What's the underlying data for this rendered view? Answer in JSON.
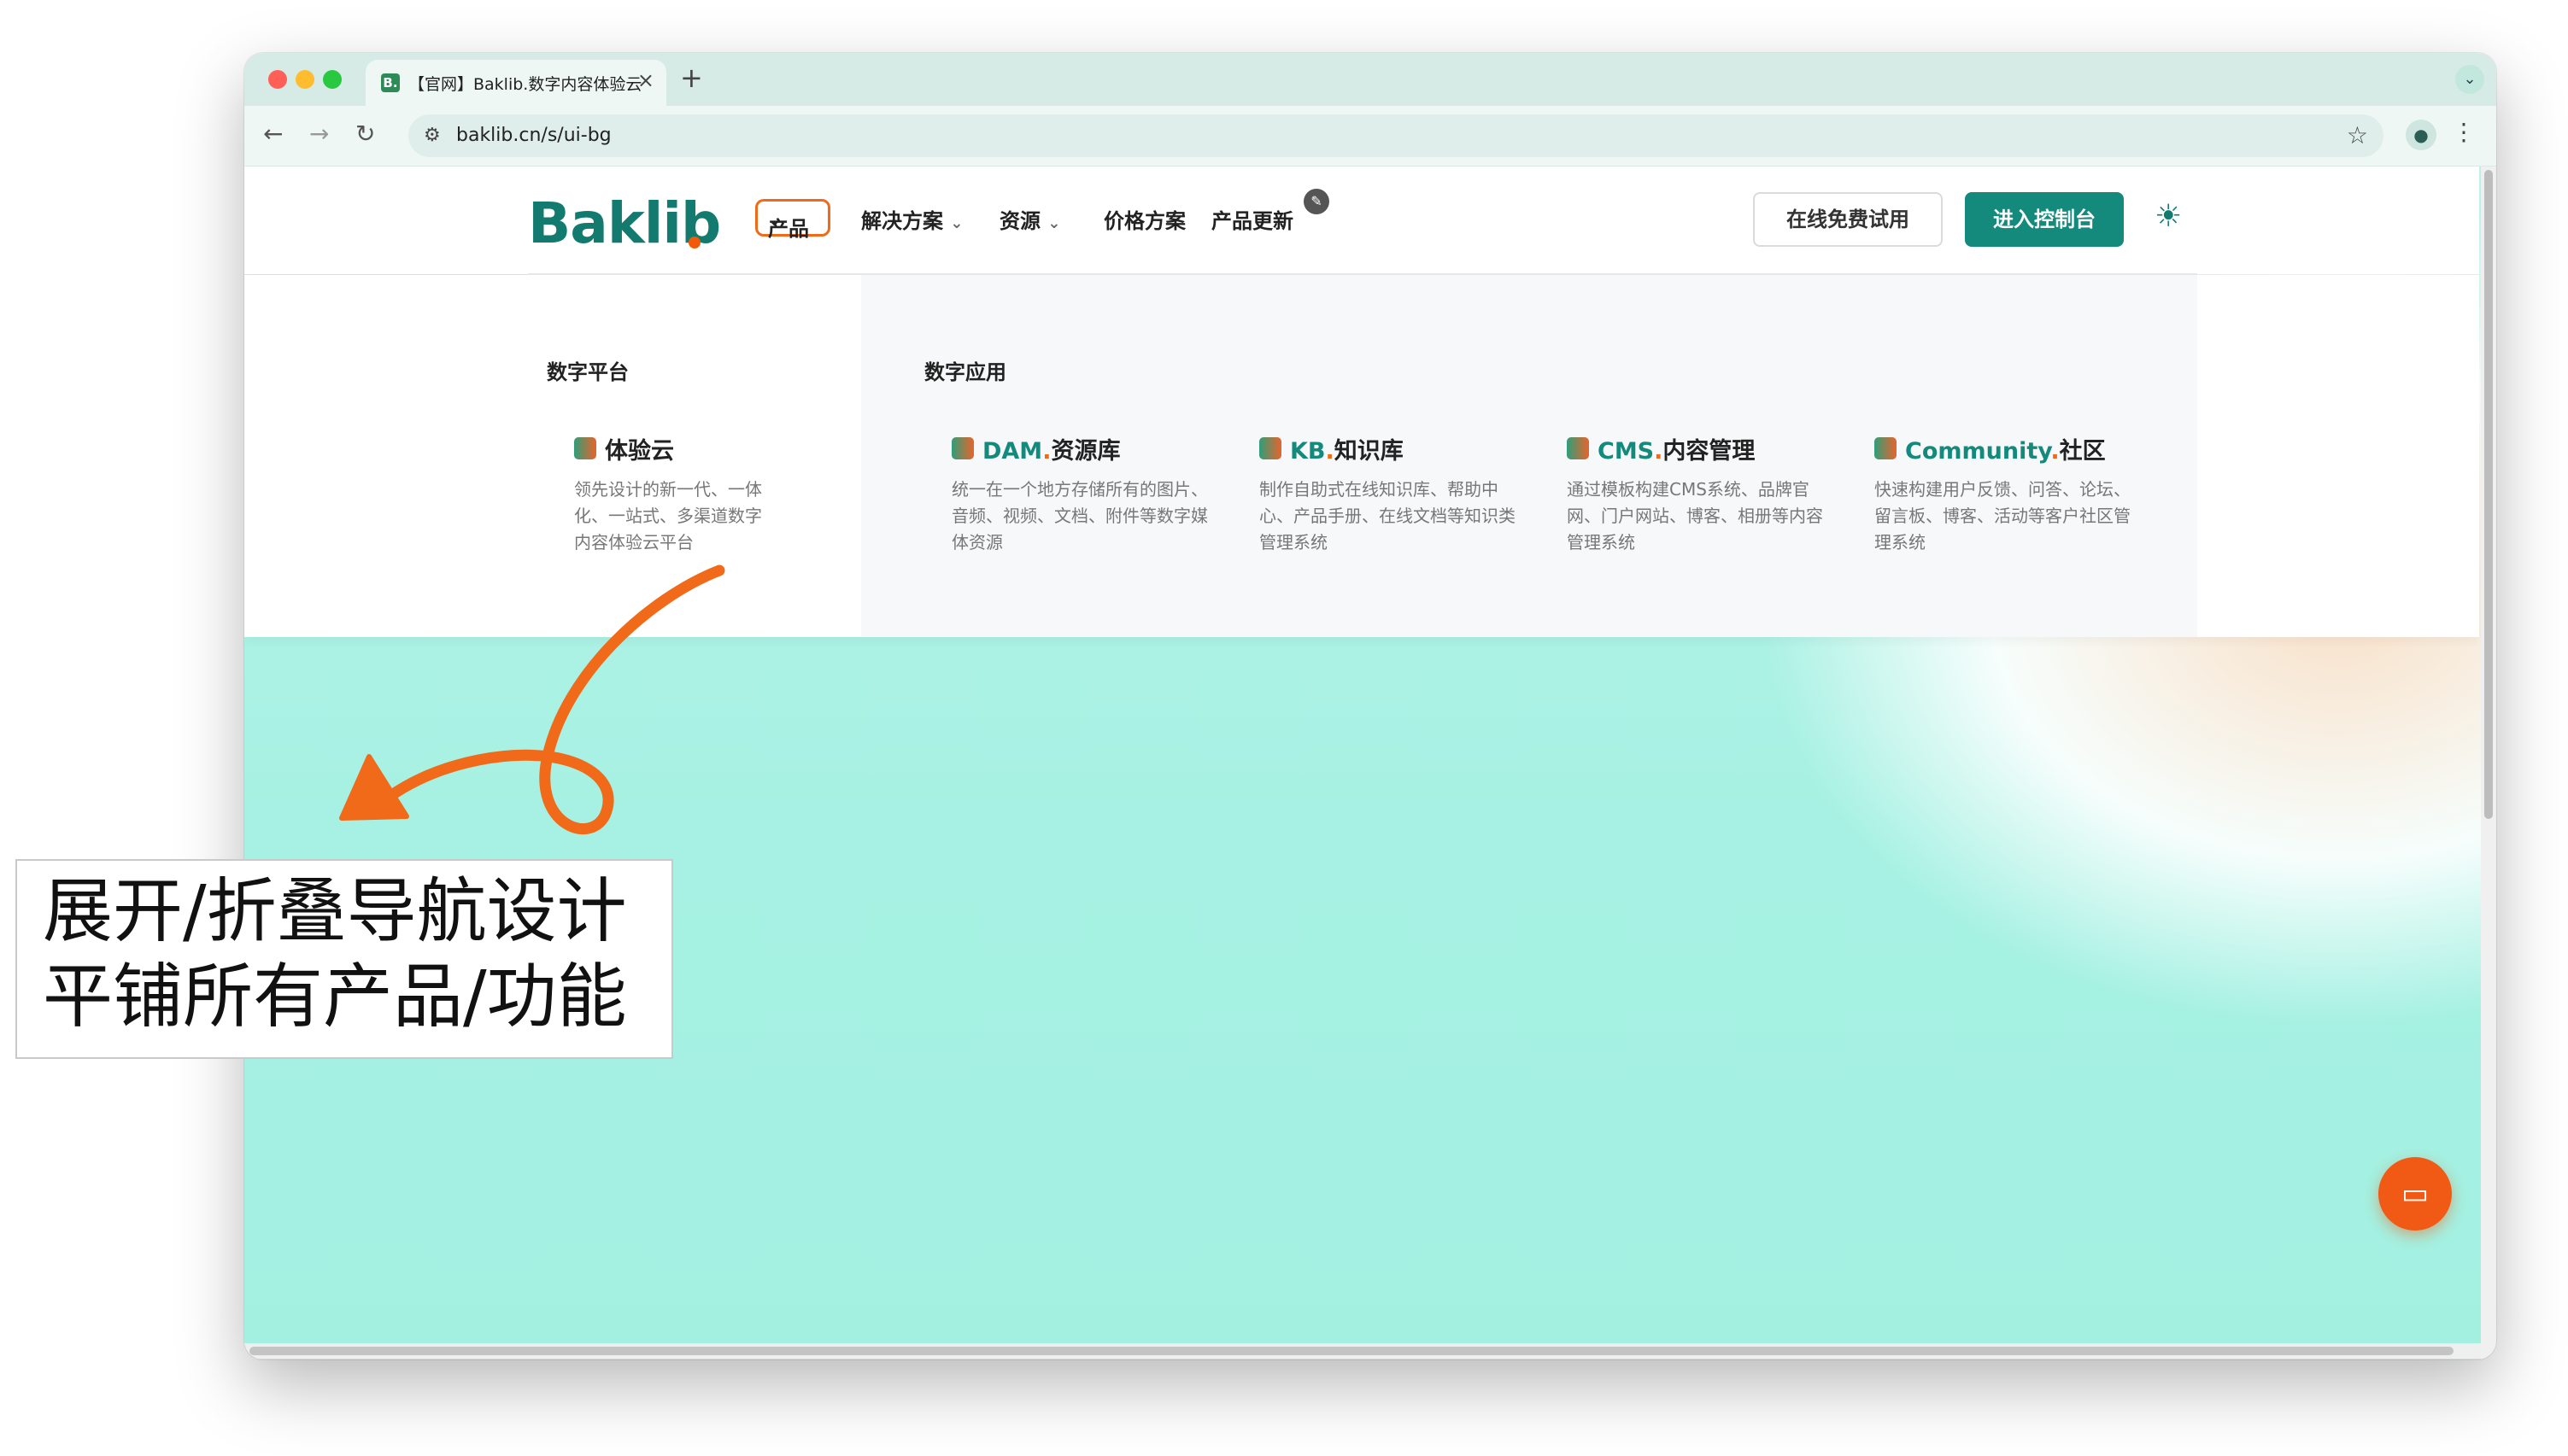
{
  "browser": {
    "tab_title": "【官网】Baklib.数字内容体验云",
    "favicon_text": "B.",
    "new_tab_label": "+",
    "url": "baklib.cn/s/ui-bg"
  },
  "site": {
    "logo": "Baklib",
    "nav": {
      "product": "产品",
      "solutions": "解决方案",
      "resources": "资源",
      "pricing": "价格方案",
      "updates": "产品更新"
    },
    "trial_button": "在线免费试用",
    "console_button": "进入控制台",
    "accent_color": "#138a7c",
    "highlight_color": "#f06a1a"
  },
  "mega_menu": {
    "platform_heading": "数字平台",
    "apps_heading": "数字应用",
    "platform_items": [
      {
        "title": "体验云",
        "desc": "领先设计的新一代、一体化、一站式、多渠道数字内容体验云平台"
      }
    ],
    "app_items": [
      {
        "brand": "DAM",
        "title": "资源库",
        "desc": "统一在一个地方存储所有的图片、音频、视频、文档、附件等数字媒体资源"
      },
      {
        "brand": "KB",
        "title": "知识库",
        "desc": "制作自助式在线知识库、帮助中心、产品手册、在线文档等知识类管理系统"
      },
      {
        "brand": "CMS",
        "title": "内容管理",
        "desc": "通过模板构建CMS系统、品牌官网、门户网站、博客、相册等内容管理系统"
      },
      {
        "brand": "Community",
        "title": "社区",
        "desc": "快速构建用户反馈、问答、论坛、留言板、博客、活动等客户社区管理系统"
      }
    ]
  },
  "annotation": {
    "line1": "展开/折叠导航设计",
    "line2": "平铺所有产品/功能"
  }
}
